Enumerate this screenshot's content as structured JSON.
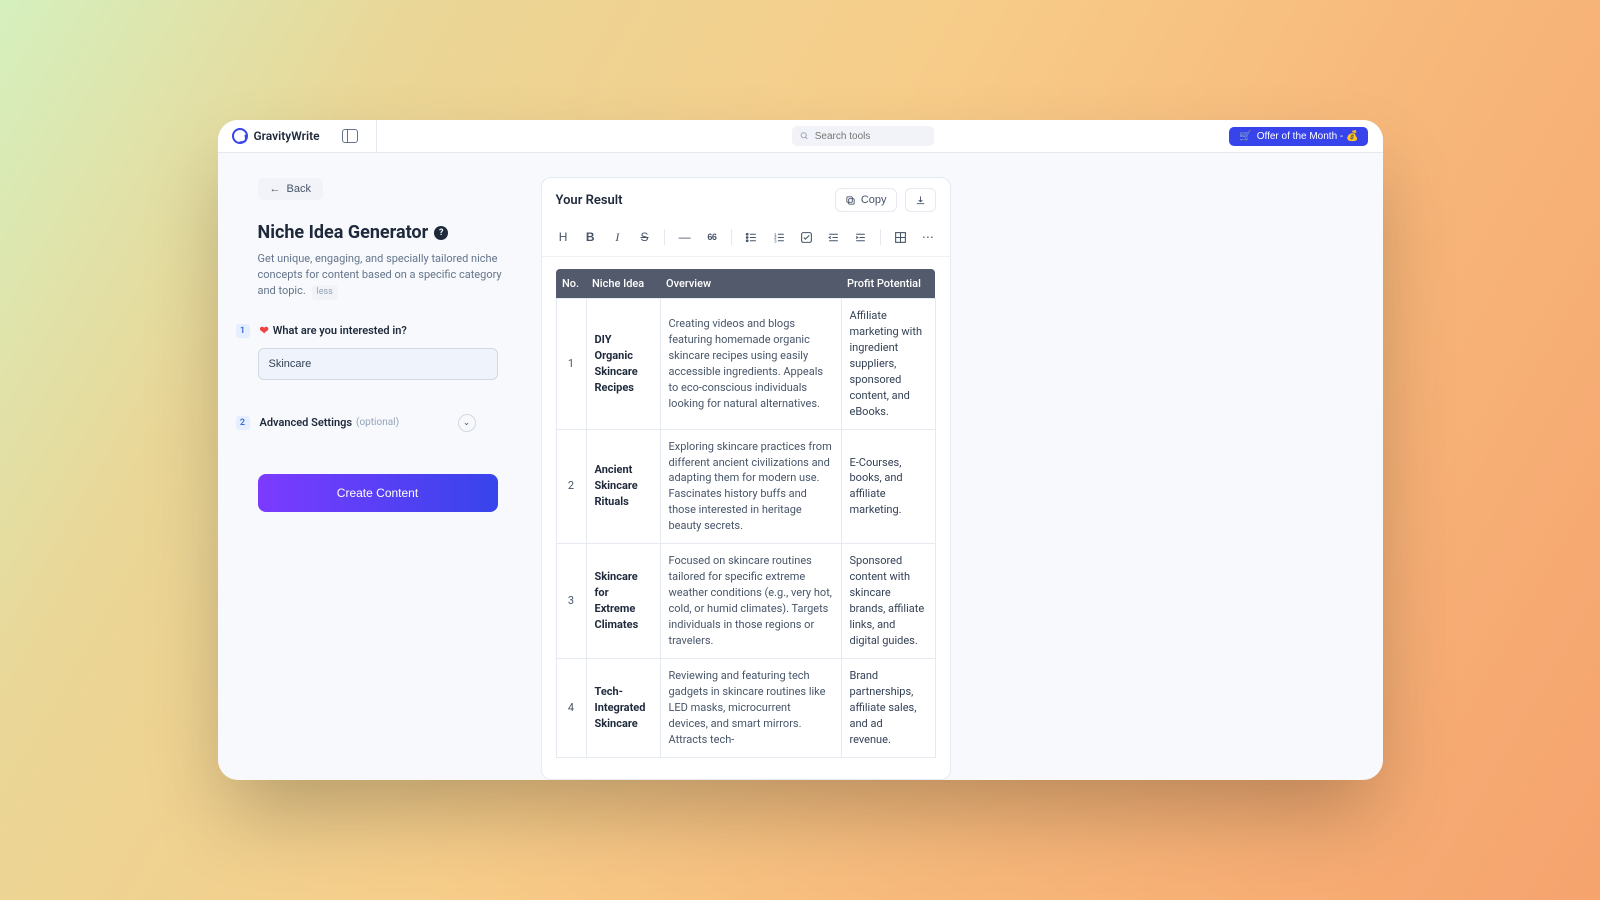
{
  "brand": "GravityWrite",
  "search_placeholder": "Search tools",
  "offer_button": "Offer of the Month - 💰",
  "back_label": "Back",
  "page_title": "Niche Idea Generator",
  "page_desc": "Get unique, engaging, and specially tailored niche concepts for content based on a specific category and topic.",
  "less_label": "less",
  "step1": {
    "num": "1",
    "label": "What are you interested in?"
  },
  "interest_value": "Skincare",
  "step2": {
    "num": "2",
    "label": "Advanced Settings",
    "optional": "(optional)"
  },
  "create_label": "Create Content",
  "result_title": "Your Result",
  "copy_label": "Copy",
  "toolbar": {
    "quote": "66"
  },
  "table": {
    "headers": {
      "no": "No.",
      "idea": "Niche Idea",
      "overview": "Overview",
      "profit": "Profit Potential"
    },
    "rows": [
      {
        "no": "1",
        "idea": "DIY Organic Skincare Recipes",
        "overview": "Creating videos and blogs featuring homemade organic skincare recipes using easily accessible ingredients. Appeals to eco-conscious individuals looking for natural alternatives.",
        "profit": "Affiliate marketing with ingredient suppliers, sponsored content, and eBooks."
      },
      {
        "no": "2",
        "idea": "Ancient Skincare Rituals",
        "overview": "Exploring skincare practices from different ancient civilizations and adapting them for modern use. Fascinates history buffs and those interested in heritage beauty secrets.",
        "profit": "E-Courses, books, and affiliate marketing."
      },
      {
        "no": "3",
        "idea": "Skincare for Extreme Climates",
        "overview": "Focused on skincare routines tailored for specific extreme weather conditions (e.g., very hot, cold, or humid climates). Targets individuals in those regions or travelers.",
        "profit": "Sponsored content with skincare brands, affiliate links, and digital guides."
      },
      {
        "no": "4",
        "idea": "Tech-Integrated Skincare",
        "overview": "Reviewing and featuring tech gadgets in skincare routines like LED masks, microcurrent devices, and smart mirrors. Attracts tech-",
        "profit": "Brand partnerships, affiliate sales, and ad revenue."
      }
    ]
  }
}
